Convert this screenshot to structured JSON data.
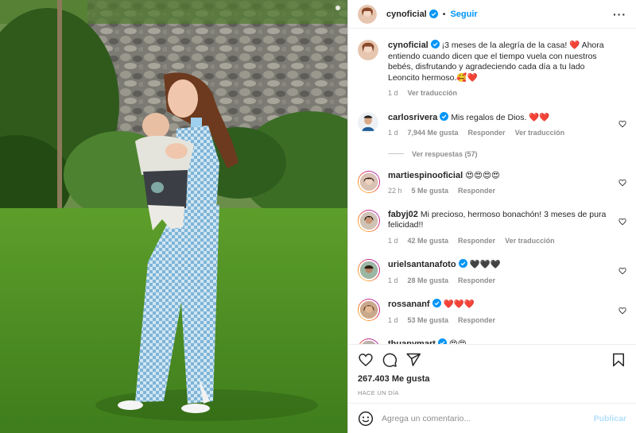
{
  "colors": {
    "accent": "#0095f6",
    "verified": "#0095f6",
    "heart": "#ed4956",
    "muted": "#8e8e8e"
  },
  "header": {
    "username": "cynoficial",
    "separator": "•",
    "follow_label": "Seguir",
    "more_icon": "more-horizontal-icon"
  },
  "caption": {
    "username": "cynoficial",
    "text": "¡3 meses de la alegría de la casa! ❤️ Ahora entiendo cuando dicen que el tiempo vuela con nuestros bebés, disfrutando y agradeciendo cada día a tu lado Leoncito hermoso.🥰❤️",
    "time": "1 d",
    "translate": "Ver traducción"
  },
  "comments": [
    {
      "username": "carlosrivera",
      "text": "Mis regalos de Dios. ❤️❤️",
      "time": "1 d",
      "likes": "7,944 Me gusta",
      "reply": "Responder",
      "translate": "Ver traducción",
      "replies_label": "Ver respuestas (57)"
    },
    {
      "username": "martiespinooficial",
      "text": "😍😍😍😍",
      "time": "22 h",
      "likes": "5 Me gusta",
      "reply": "Responder"
    },
    {
      "username": "fabyj02",
      "text": "Mi precioso, hermoso bonachón! 3 meses de pura felicidad!!",
      "time": "1 d",
      "likes": "42 Me gusta",
      "reply": "Responder",
      "translate": "Ver traducción"
    },
    {
      "username": "urielsantanafoto",
      "text": "🖤🖤🖤",
      "time": "1 d",
      "likes": "28 Me gusta",
      "reply": "Responder"
    },
    {
      "username": "rossananf",
      "text": "❤️❤️❤️",
      "time": "1 d",
      "likes": "53 Me gusta",
      "reply": "Responder"
    },
    {
      "username": "thuanymart",
      "text": "😍😍"
    }
  ],
  "actions": {
    "like_icon": "heart-icon",
    "comment_icon": "comment-icon",
    "share_icon": "share-icon",
    "save_icon": "bookmark-icon"
  },
  "likes": "267.403 Me gusta",
  "posted": "HACE UN DÍA",
  "composer": {
    "emoji_icon": "emoji-icon",
    "placeholder": "Agrega un comentario...",
    "publish": "Publicar"
  }
}
